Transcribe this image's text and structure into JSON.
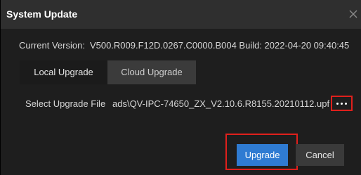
{
  "dialog": {
    "title": "System Update",
    "close_icon": "close-icon"
  },
  "version": {
    "label": "Current Version:",
    "value": "V500.R009.F12D.0267.C0000.B004 Build: 2022-04-20 09:40:45"
  },
  "tabs": [
    {
      "label": "Local Upgrade",
      "selected": true
    },
    {
      "label": "Cloud Upgrade",
      "selected": false
    }
  ],
  "file": {
    "label": "Select Upgrade File",
    "path_visible": "ads\\QV-IPC-74650_ZX_V2.10.6.R8155.20210112.upf",
    "browse_icon": "more-dots-icon"
  },
  "buttons": {
    "upgrade": "Upgrade",
    "cancel": "Cancel"
  },
  "colors": {
    "highlight": "#e0201c",
    "primary": "#2f7bd2",
    "background": "#1e1e1e"
  }
}
